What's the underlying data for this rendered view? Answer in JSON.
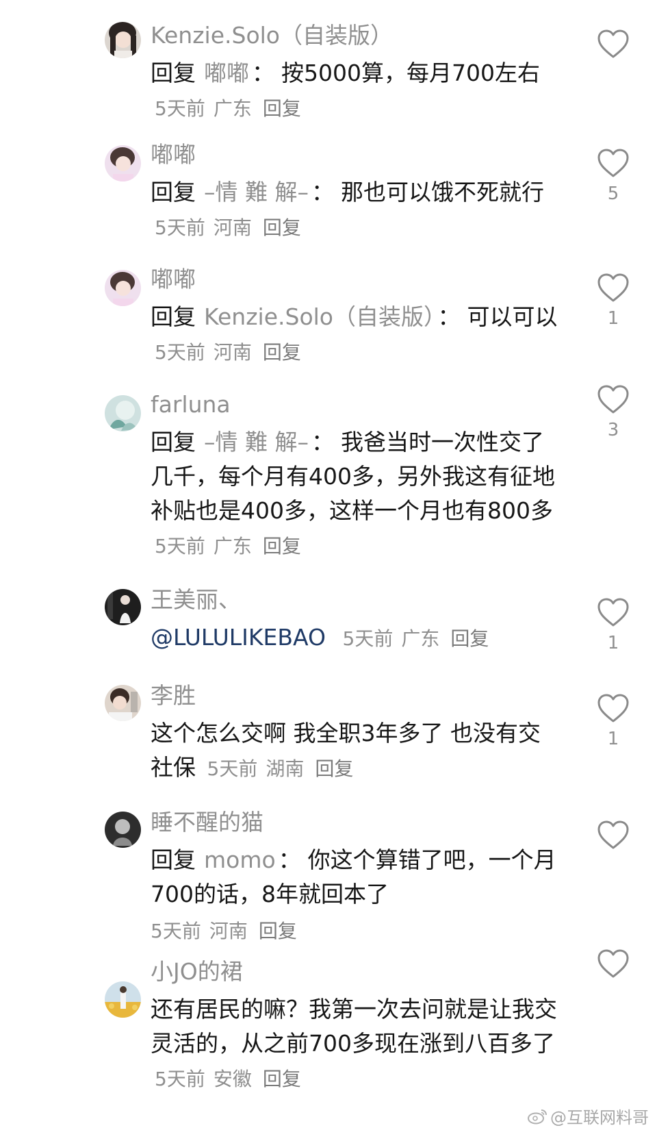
{
  "comments": [
    {
      "username": "Kenzie.Solo（自装版）",
      "reply_word": "回复",
      "reply_to": "嘟嘟",
      "text": "按5000算，每月700左右",
      "time": "5天前",
      "location": "广东",
      "reply_label": "回复",
      "likes": "",
      "avatar_color": "#d8d2cc"
    },
    {
      "username": "嘟嘟",
      "reply_word": "回复",
      "reply_to": "–情 難 解–",
      "text": "那也可以饿不死就行",
      "time": "5天前",
      "location": "河南",
      "reply_label": "回复",
      "likes": "5",
      "avatar_color": "#e9dbe8"
    },
    {
      "username": "嘟嘟",
      "reply_word": "回复",
      "reply_to": "Kenzie.Solo（自装版）",
      "text": "可以可以",
      "time": "5天前",
      "location": "河南",
      "reply_label": "回复",
      "likes": "1",
      "avatar_color": "#e9dbe8"
    },
    {
      "username": "farluna",
      "reply_word": "回复",
      "reply_to": "–情 難 解–",
      "text": "我爸当时一次性交了几千，每个月有400多，另外我这有征地补贴也是400多，这样一个月也有800多",
      "time": "5天前",
      "location": "广东",
      "reply_label": "回复",
      "likes": "3",
      "avatar_color": "#c9dcdc"
    },
    {
      "username": "王美丽、",
      "mention": "@LULULIKEBAO",
      "time": "5天前",
      "location": "广东",
      "reply_label": "回复",
      "likes": "1",
      "avatar_color": "#2e2e2e"
    },
    {
      "username": "李胜",
      "text": "这个怎么交啊 我全职3年多了 也没有交社保",
      "time": "5天前",
      "location": "湖南",
      "reply_label": "回复",
      "likes": "1",
      "avatar_color": "#d9cfc7"
    },
    {
      "username": "睡不醒的猫",
      "reply_word": "回复",
      "reply_to": "momo",
      "text": "你这个算错了吧，一个月700的话，8年就回本了",
      "time": "5天前",
      "location": "河南",
      "reply_label": "回复",
      "likes": "",
      "avatar_color": "#3a3a3a"
    },
    {
      "username": "小JO的裙",
      "text": "还有居民的嘛？我第一次去问就是让我交灵活的，从之前700多现在涨到八百多了",
      "time": "5天前",
      "location": "安徽",
      "reply_label": "回复",
      "likes": "",
      "avatar_color": "#e7c879"
    }
  ],
  "colon": "：",
  "watermark": "@互联网料哥",
  "icons": {
    "like": "heart-outline-icon",
    "weibo": "weibo-icon"
  }
}
